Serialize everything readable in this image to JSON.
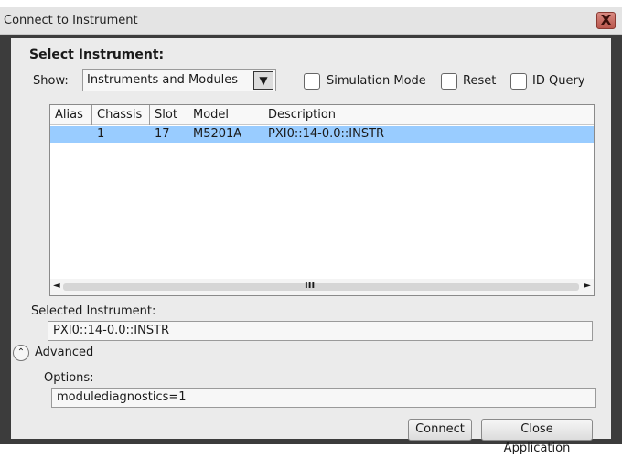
{
  "window": {
    "title": "Connect to Instrument",
    "close_label": "X"
  },
  "select_instrument": {
    "heading": "Select Instrument:"
  },
  "show": {
    "label": "Show:",
    "value": "Instruments and Modules"
  },
  "checkboxes": [
    {
      "label": "Simulation Mode",
      "checked": false
    },
    {
      "label": "Reset",
      "checked": false
    },
    {
      "label": "ID Query",
      "checked": false
    }
  ],
  "table": {
    "headers": [
      "Alias",
      "Chassis",
      "Slot",
      "Model",
      "Description"
    ],
    "rows": [
      {
        "alias": "",
        "chassis": "1",
        "slot": "17",
        "model": "M5201A",
        "description": "PXI0::14-0.0::INSTR",
        "selected": true
      }
    ],
    "scroll_left": "◄",
    "scroll_thumb": "III",
    "scroll_right": "►"
  },
  "selected_instrument": {
    "label": "Selected Instrument:",
    "value": "PXI0::14-0.0::INSTR"
  },
  "advanced": {
    "label": "Advanced",
    "icon": "chevron-up-circle-icon"
  },
  "options": {
    "label": "Options:",
    "value": "modulediagnostics=1"
  },
  "buttons": {
    "connect": "Connect",
    "close_application": "Close Application"
  },
  "colors": {
    "selection": "#99ccff",
    "frame": "#3c3c3c",
    "close": "#c46a60"
  }
}
